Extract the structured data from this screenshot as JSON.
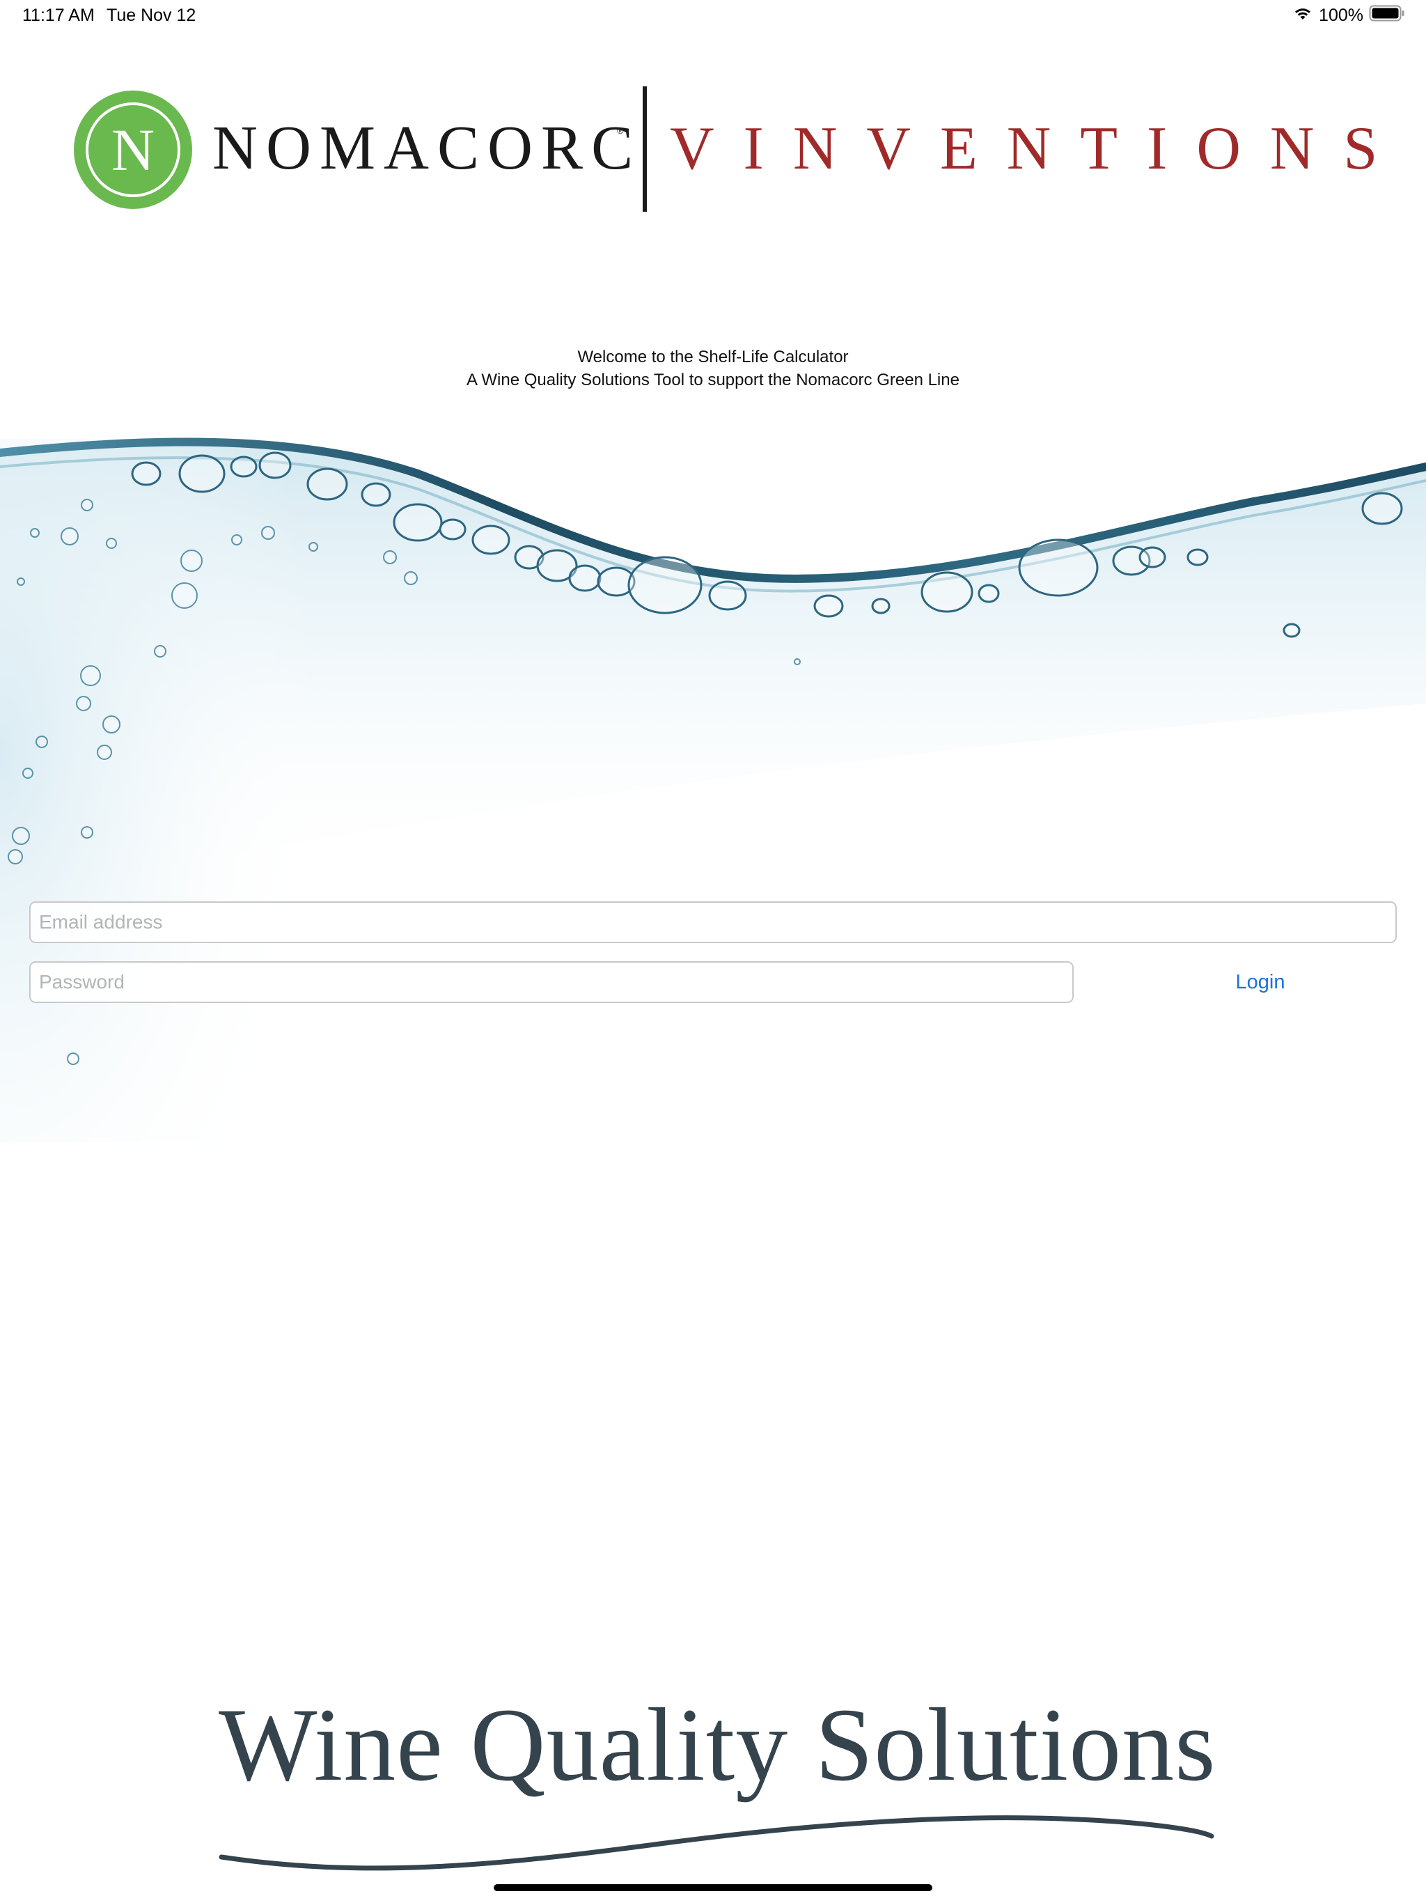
{
  "status_bar": {
    "time": "11:17 AM",
    "date": "Tue Nov 12",
    "battery": "100%",
    "wifi_icon": "wifi-icon",
    "battery_icon": "battery-full-icon"
  },
  "brand": {
    "badge_letter": "N",
    "primary": "NOMACORC",
    "registered_mark": "®",
    "secondary": "VINVENTIONS",
    "colors": {
      "badge_green": "#6ab94e",
      "vinventions_red": "#a02a2a",
      "wordmark_slate": "#35434d",
      "link_blue": "#1a73d9"
    }
  },
  "welcome": {
    "line1": "Welcome to the Shelf-Life Calculator",
    "line2": "A Wine Quality Solutions Tool to support the Nomacorc Green Line"
  },
  "login_form": {
    "email_value": "",
    "email_placeholder": "Email address",
    "password_value": "",
    "password_placeholder": "Password",
    "login_label": "Login"
  },
  "footer": {
    "wordmark": "Wine Quality Solutions"
  }
}
